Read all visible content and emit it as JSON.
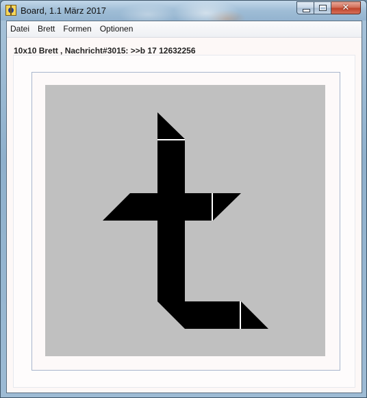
{
  "window": {
    "title": "Board, 1.1 März 2017",
    "buttons": {
      "minimize": "minimize",
      "maximize": "maximize",
      "close": "✕"
    }
  },
  "menu": [
    {
      "label": "Datei"
    },
    {
      "label": "Brett"
    },
    {
      "label": "Formen"
    },
    {
      "label": "Optionen"
    }
  ],
  "status": {
    "text": "10x10 Brett , Nachricht#3015: >>b 17 12632256"
  },
  "board": {
    "background": "#c0c0c0",
    "piece_color": "#000000",
    "separator_color": "#ffffff",
    "pieces": [
      {
        "name": "top-triangle"
      },
      {
        "name": "vertical-bar"
      },
      {
        "name": "left-parallelogram"
      },
      {
        "name": "right-triangle"
      },
      {
        "name": "bottom-bar"
      },
      {
        "name": "bottom-right-triangle"
      }
    ]
  }
}
